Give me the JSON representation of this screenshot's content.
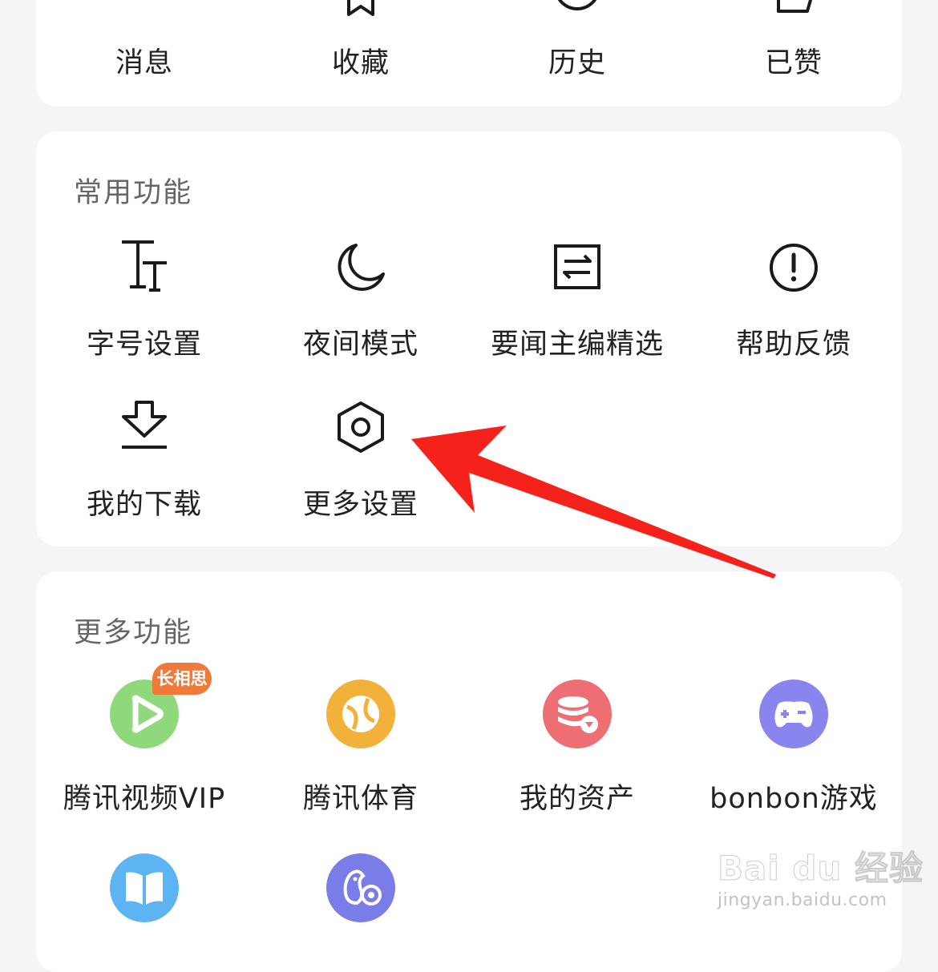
{
  "top_row": {
    "items": [
      {
        "label": "消息",
        "icon": "message-icon"
      },
      {
        "label": "收藏",
        "icon": "star-icon"
      },
      {
        "label": "历史",
        "icon": "clock-icon"
      },
      {
        "label": "已赞",
        "icon": "thumbs-up-icon"
      }
    ]
  },
  "common": {
    "title": "常用功能",
    "items": [
      {
        "label": "字号设置",
        "icon": "font-size-icon"
      },
      {
        "label": "夜间模式",
        "icon": "moon-icon"
      },
      {
        "label": "要闻主编精选",
        "icon": "swap-icon"
      },
      {
        "label": "帮助反馈",
        "icon": "alert-circle-icon"
      },
      {
        "label": "我的下载",
        "icon": "download-icon"
      },
      {
        "label": "更多设置",
        "icon": "hexagon-settings-icon"
      }
    ]
  },
  "more": {
    "title": "更多功能",
    "badge": "长相思",
    "items": [
      {
        "label": "腾讯视频VIP",
        "icon": "video-play-icon",
        "color": "#8fd87c"
      },
      {
        "label": "腾讯体育",
        "icon": "sports-ball-icon",
        "color": "#f2b23a"
      },
      {
        "label": "我的资产",
        "icon": "coins-icon",
        "color": "#ee6f73"
      },
      {
        "label": "bonbon游戏",
        "icon": "gamepad-icon",
        "color": "#8a84ee"
      },
      {
        "icon": "book-icon",
        "color": "#5cb4f2"
      },
      {
        "icon": "penguin-icon",
        "color": "#7a7ce8"
      }
    ]
  },
  "watermark": {
    "main": "Bai du 经验",
    "sub": "jingyan.baidu.com"
  },
  "colors": {
    "arrow": "#f5221c",
    "badge": "#f07a3a"
  }
}
